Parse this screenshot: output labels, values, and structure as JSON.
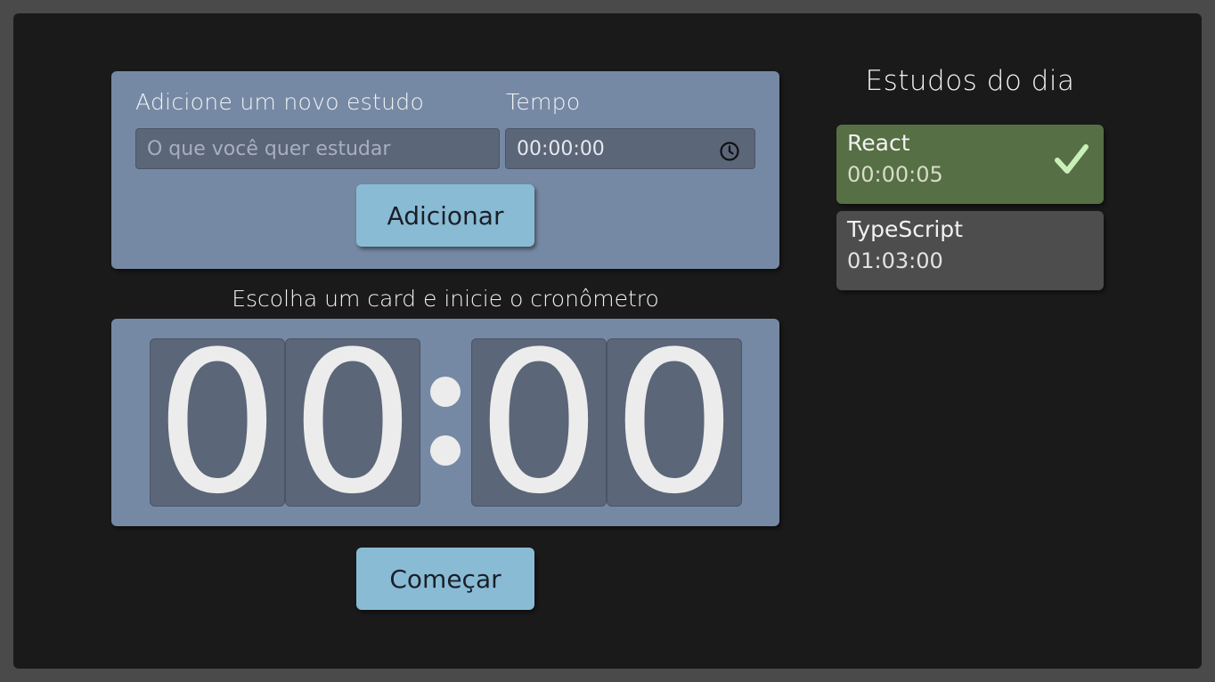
{
  "form": {
    "study_label": "Adicione um novo estudo",
    "time_label": "Tempo",
    "study_placeholder": "O que você quer estudar",
    "time_value": "00:00:00",
    "time_icon": "clock-icon",
    "add_button": "Adicionar"
  },
  "timer": {
    "hint": "Escolha um card e inicie o cronômetro",
    "digits": [
      "0",
      "0",
      "0",
      "0"
    ],
    "start_button": "Começar"
  },
  "sidebar": {
    "title": "Estudos do dia",
    "items": [
      {
        "name": "React",
        "time": "00:00:05",
        "completed": true,
        "status_icon": "check-icon"
      },
      {
        "name": "TypeScript",
        "time": "01:03:00",
        "completed": false
      }
    ]
  },
  "colors": {
    "page_bg": "#4a4a4a",
    "app_bg": "#1a1a1a",
    "panel": "#7689a4",
    "field_bg": "#5b6678",
    "button": "#89bcd4",
    "card_completed": "#566f45",
    "card_default": "#4d4d4d",
    "check": "#c9f0b8"
  }
}
